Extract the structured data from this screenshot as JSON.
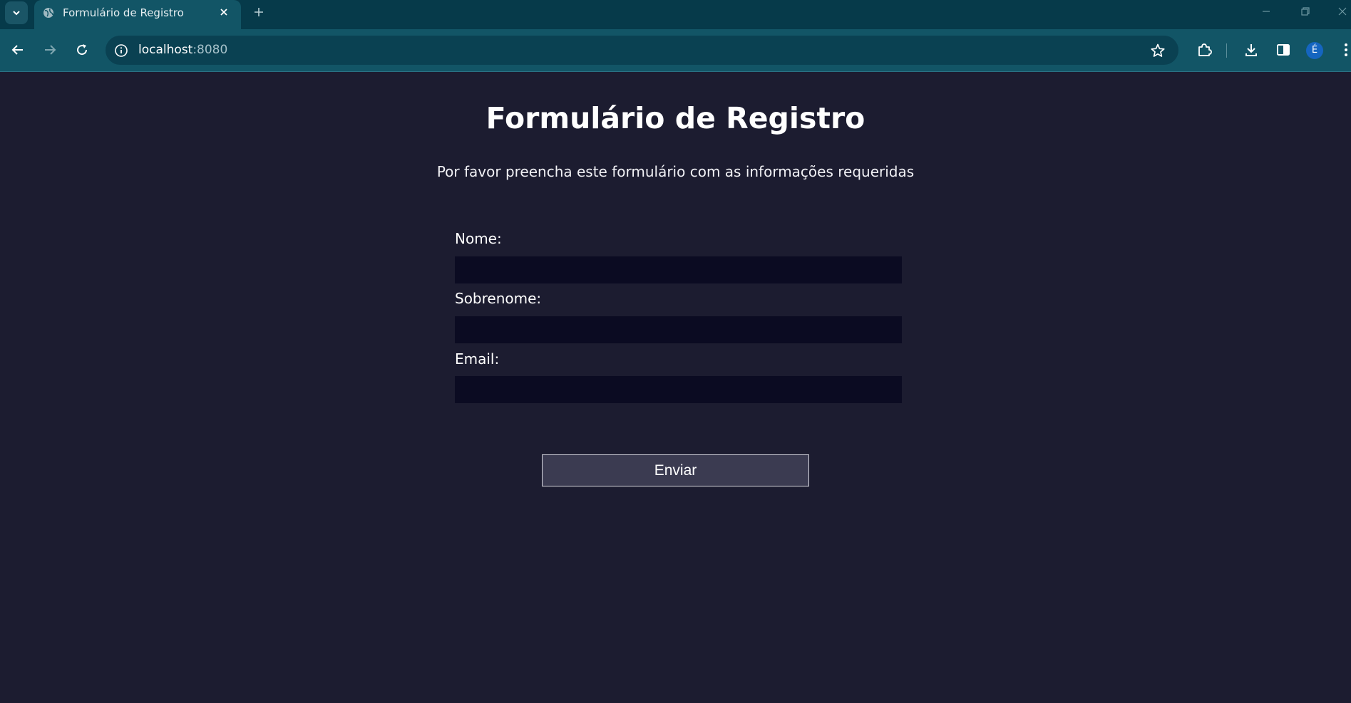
{
  "browser": {
    "tab_title": "Formulário de Registro",
    "url_host": "localhost",
    "url_port": ":8080",
    "profile_initial": "É"
  },
  "page": {
    "title": "Formulário de Registro",
    "subtitle": "Por favor preencha este formulário com as informações requeridas"
  },
  "form": {
    "fields": [
      {
        "label": "Nome:",
        "value": ""
      },
      {
        "label": "Sobrenome:",
        "value": ""
      },
      {
        "label": "Email:",
        "value": ""
      }
    ],
    "submit_label": "Enviar"
  },
  "colors": {
    "page_background": "#1c1c30",
    "input_background": "#0b0b22",
    "button_background": "#3b3b51",
    "toolbar": "#125566",
    "tabstrip": "#063a4a"
  }
}
